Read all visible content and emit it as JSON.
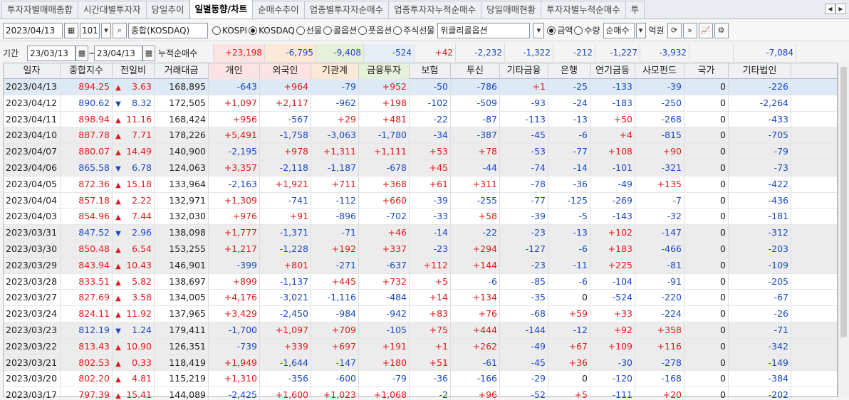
{
  "tabs": [
    "투자자별매매종합",
    "시간대별투자자",
    "당일추이",
    "일별동향/차트",
    "순매수추이",
    "업종별투자자순매수",
    "업종투자자누적순매수",
    "당일매매현황",
    "투자자별누적순매수",
    "투"
  ],
  "active_tab": 3,
  "toolbar": {
    "date": "2023/04/13",
    "code": "101",
    "market_name": "종합(KOSDAQ)",
    "radios": [
      {
        "label": "KOSPI",
        "checked": false
      },
      {
        "label": "KOSDAQ",
        "checked": true
      },
      {
        "label": "선물",
        "checked": false
      },
      {
        "label": "콜옵션",
        "checked": false
      },
      {
        "label": "풋옵션",
        "checked": false
      },
      {
        "label": "주식선물",
        "checked": false
      },
      {
        "label": "위클리콜옵션",
        "checked": false
      }
    ],
    "unit_radios": [
      {
        "label": "금액",
        "checked": true
      },
      {
        "label": "수량",
        "checked": false
      }
    ],
    "type_select": "순매수",
    "unit_label": "억원"
  },
  "period": {
    "label": "기간",
    "from": "23/03/13",
    "to": "23/04/13",
    "cumulative_label": "누적순매수"
  },
  "summary": [
    "+23,198",
    "-6,795",
    "-9,408",
    "-524",
    "+42",
    "-2,232",
    "-1,322",
    "-212",
    "-1,227",
    "-3,932",
    "",
    "-7,084"
  ],
  "headers": [
    "일자",
    "종합지수",
    "전일비",
    "거래대금",
    "개인",
    "외국인",
    "기관계",
    "금융투자",
    "보험",
    "투신",
    "기타금융",
    "은행",
    "연기금등",
    "사모펀드",
    "국가",
    "기타법인"
  ],
  "rows": [
    [
      "2023/04/13",
      "894.25",
      "up",
      "3.63",
      "168,895",
      "-643",
      "+964",
      "-79",
      "+952",
      "-50",
      "-786",
      "+1",
      "-25",
      "-133",
      "-39",
      "0",
      "-226"
    ],
    [
      "2023/04/12",
      "890.62",
      "dn",
      "8.32",
      "172,505",
      "+1,097",
      "+2,117",
      "-962",
      "+198",
      "-102",
      "-509",
      "-93",
      "-24",
      "-183",
      "-250",
      "0",
      "-2,264"
    ],
    [
      "2023/04/11",
      "898.94",
      "up",
      "11.16",
      "168,424",
      "+956",
      "-567",
      "+29",
      "+481",
      "-22",
      "-87",
      "-113",
      "-13",
      "+50",
      "-268",
      "0",
      "-433"
    ],
    [
      "2023/04/10",
      "887.78",
      "up",
      "7.71",
      "178,226",
      "+5,491",
      "-1,758",
      "-3,063",
      "-1,780",
      "-34",
      "-387",
      "-45",
      "-6",
      "+4",
      "-815",
      "0",
      "-705"
    ],
    [
      "2023/04/07",
      "880.07",
      "up",
      "14.49",
      "140,900",
      "-2,195",
      "+978",
      "+1,311",
      "+1,111",
      "+53",
      "+78",
      "-53",
      "-77",
      "+108",
      "+90",
      "0",
      "-79"
    ],
    [
      "2023/04/06",
      "865.58",
      "dn",
      "6.78",
      "124,063",
      "+3,357",
      "-2,118",
      "-1,187",
      "-678",
      "+45",
      "-44",
      "-74",
      "-14",
      "-101",
      "-321",
      "0",
      "-73"
    ],
    [
      "2023/04/05",
      "872.36",
      "up",
      "15.18",
      "133,964",
      "-2,163",
      "+1,921",
      "+711",
      "+368",
      "+61",
      "+311",
      "-78",
      "-36",
      "-49",
      "+135",
      "0",
      "-422"
    ],
    [
      "2023/04/04",
      "857.18",
      "up",
      "2.22",
      "132,971",
      "+1,309",
      "-741",
      "-112",
      "+660",
      "-39",
      "-255",
      "-77",
      "-125",
      "-269",
      "-7",
      "0",
      "-436"
    ],
    [
      "2023/04/03",
      "854.96",
      "up",
      "7.44",
      "132,030",
      "+976",
      "+91",
      "-896",
      "-702",
      "-33",
      "+58",
      "-39",
      "-5",
      "-143",
      "-32",
      "0",
      "-181"
    ],
    [
      "2023/03/31",
      "847.52",
      "dn",
      "2.96",
      "138,098",
      "+1,777",
      "-1,371",
      "-71",
      "+46",
      "-14",
      "-22",
      "-23",
      "-13",
      "+102",
      "-147",
      "0",
      "-312"
    ],
    [
      "2023/03/30",
      "850.48",
      "up",
      "6.54",
      "153,255",
      "+1,217",
      "-1,228",
      "+192",
      "+337",
      "-23",
      "+294",
      "-127",
      "-6",
      "+183",
      "-466",
      "0",
      "-203"
    ],
    [
      "2023/03/29",
      "843.94",
      "up",
      "10.43",
      "146,901",
      "-399",
      "+801",
      "-271",
      "-637",
      "+112",
      "+144",
      "-23",
      "-11",
      "+225",
      "-81",
      "0",
      "-109"
    ],
    [
      "2023/03/28",
      "833.51",
      "up",
      "5.82",
      "138,697",
      "+899",
      "-1,137",
      "+445",
      "+732",
      "+5",
      "-6",
      "-85",
      "-6",
      "-104",
      "-91",
      "0",
      "-205"
    ],
    [
      "2023/03/27",
      "827.69",
      "up",
      "3.58",
      "134,005",
      "+4,176",
      "-3,021",
      "-1,116",
      "-484",
      "+14",
      "+134",
      "-35",
      "0",
      "-524",
      "-220",
      "0",
      "-67"
    ],
    [
      "2023/03/24",
      "824.11",
      "up",
      "11.92",
      "137,965",
      "+3,429",
      "-2,450",
      "-984",
      "-942",
      "+83",
      "+76",
      "-68",
      "+59",
      "+33",
      "-224",
      "0",
      "-26"
    ],
    [
      "2023/03/23",
      "812.19",
      "dn",
      "1.24",
      "179,411",
      "-1,700",
      "+1,097",
      "+709",
      "-105",
      "+75",
      "+444",
      "-144",
      "-12",
      "+92",
      "+358",
      "0",
      "-71"
    ],
    [
      "2023/03/22",
      "813.43",
      "up",
      "10.90",
      "126,351",
      "-739",
      "+339",
      "+697",
      "+191",
      "+1",
      "+262",
      "-49",
      "+67",
      "+109",
      "+116",
      "0",
      "-342"
    ],
    [
      "2023/03/21",
      "802.53",
      "up",
      "0.33",
      "118,419",
      "+1,949",
      "-1,644",
      "-147",
      "+180",
      "+51",
      "-61",
      "-45",
      "+36",
      "-30",
      "-278",
      "0",
      "-149"
    ],
    [
      "2023/03/20",
      "802.20",
      "up",
      "4.81",
      "115,219",
      "+1,310",
      "-356",
      "-600",
      "-79",
      "-36",
      "-166",
      "-29",
      "0",
      "-120",
      "-168",
      "0",
      "-384"
    ],
    [
      "2023/03/17",
      "797.39",
      "up",
      "15.41",
      "144,089",
      "-2,425",
      "+1,600",
      "+1,023",
      "+1,068",
      "-2",
      "+96",
      "-52",
      "+5",
      "-111",
      "+20",
      "0",
      "-202"
    ]
  ],
  "colors": {
    "up": "#e0191b",
    "down": "#1a48c4",
    "header_bg": "#eef0f4",
    "highlight": "#dde9f5"
  }
}
